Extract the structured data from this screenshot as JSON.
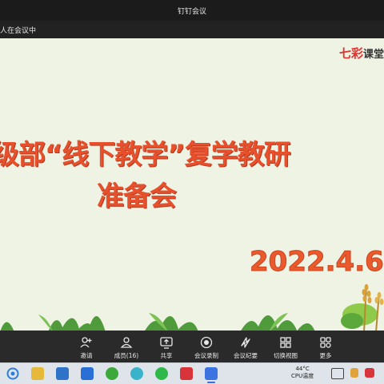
{
  "window": {
    "title": "钉钉会议"
  },
  "status": {
    "text": "人在会议中"
  },
  "slide": {
    "brand_a": "七彩",
    "brand_b": "课堂",
    "title_line1": "级部“线下教学”复学教研",
    "title_line2": "准备会",
    "date": "2022.4.6"
  },
  "toolbar": {
    "items": [
      {
        "label": "邀请",
        "icon": "invite-icon"
      },
      {
        "label": "成员(16)",
        "icon": "members-icon"
      },
      {
        "label": "共享",
        "icon": "share-screen-icon"
      },
      {
        "label": "会议录制",
        "icon": "record-icon"
      },
      {
        "label": "会议纪要",
        "icon": "minutes-icon"
      },
      {
        "label": "切换视图",
        "icon": "grid-view-icon"
      },
      {
        "label": "更多",
        "icon": "more-icon"
      }
    ]
  },
  "taskbar": {
    "cpu_temp": "44°C",
    "cpu_label": "CPU温度"
  },
  "colors": {
    "slide_bg": "#eef3e4",
    "title": "#e7502c",
    "toolbar_bg": "#2a2a2a",
    "taskbar_bg": "#dfe4ea"
  }
}
